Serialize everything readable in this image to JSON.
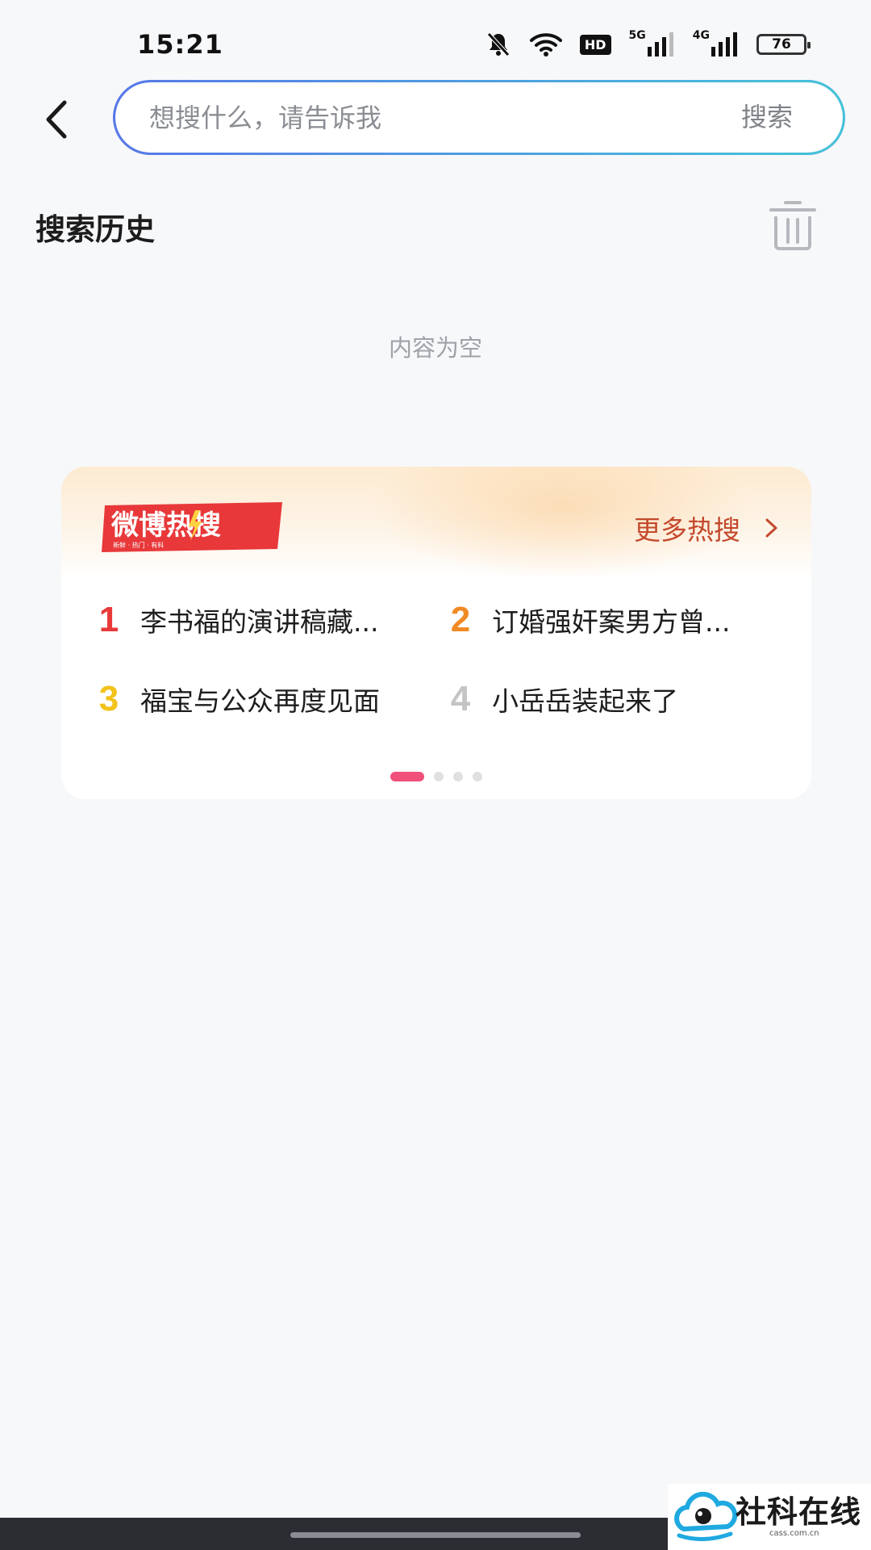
{
  "status_bar": {
    "time": "15:21",
    "hd_label": "HD",
    "net_5g": "5G",
    "net_4g": "4G",
    "battery": "76"
  },
  "search": {
    "placeholder": "想搜什么，请告诉我",
    "value": "",
    "button_label": "搜索"
  },
  "history": {
    "title": "搜索历史",
    "empty_text": "内容为空"
  },
  "hot": {
    "logo_text": "微博热搜",
    "logo_subtext": "新鲜 · 热门 · 有料",
    "more_label": "更多热搜",
    "items": [
      {
        "rank": "1",
        "text": "李书福的演讲稿藏...",
        "color": "#e83a3a"
      },
      {
        "rank": "2",
        "text": "订婚强奸案男方曾...",
        "color": "#f08a24"
      },
      {
        "rank": "3",
        "text": "福宝与公众再度见面",
        "color": "#f2c21a"
      },
      {
        "rank": "4",
        "text": "小岳岳装起来了",
        "color": "#c4c4c4"
      }
    ],
    "pager": {
      "count": 4,
      "active": 0
    }
  },
  "watermark": {
    "text": "社科在线",
    "subtext": "cass.com.cn"
  }
}
